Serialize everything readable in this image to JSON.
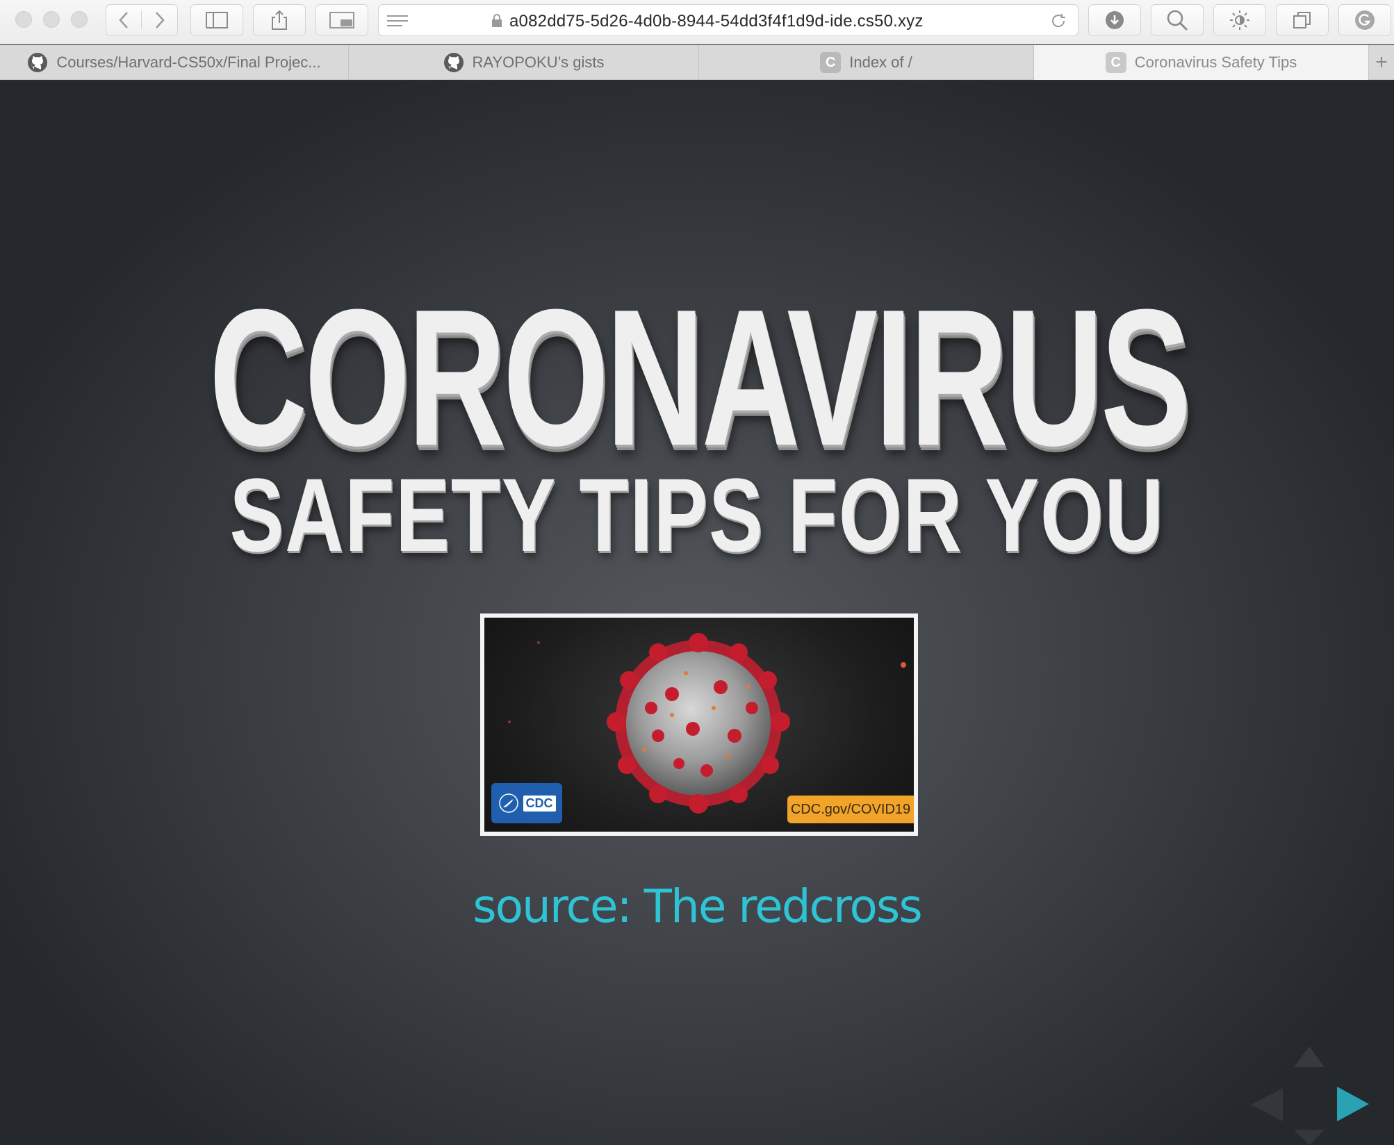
{
  "browser": {
    "address": "a082dd75-5d26-4d0b-8944-54dd3f4f1d9d-ide.cs50.xyz",
    "tabs": [
      {
        "label": "Courses/Harvard-CS50x/Final Projec...",
        "icon": "github-icon"
      },
      {
        "label": "RAYOPOKU’s gists",
        "icon": "github-icon"
      },
      {
        "label": "Index of /",
        "icon": "c-icon",
        "icon_letter": "C"
      },
      {
        "label": "Coronavirus Safety Tips",
        "icon": "c-icon",
        "icon_letter": "C",
        "active": true
      }
    ],
    "new_tab": "+"
  },
  "slide": {
    "headline": "CORONAVIRUS",
    "subheadline": "SAFETY TIPS FOR YOU",
    "image": {
      "badge_text": "CDC",
      "url_text": "CDC.gov/COVID19"
    },
    "source": "source: The redcross"
  },
  "colors": {
    "accent": "#2fc3d6",
    "background": "#3b3e43",
    "heading": "#efefef"
  }
}
